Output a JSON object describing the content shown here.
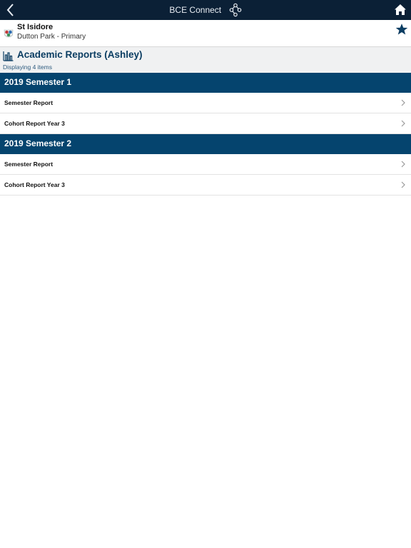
{
  "topbar": {
    "title": "BCE Connect",
    "back_icon": "chevron-left-icon",
    "logo_icon": "network-nodes-icon",
    "home_icon": "home-icon"
  },
  "school": {
    "name": "St Isidore",
    "location": "Dutton Park - Primary",
    "crest_icon": "school-crest-icon",
    "favorite_icon": "star-icon"
  },
  "page": {
    "icon": "bar-chart-icon",
    "title": "Academic Reports (Ashley)",
    "count_text": "Displaying 4 items"
  },
  "sections": [
    {
      "title": "2019 Semester 1",
      "items": [
        {
          "label": "Semester Report"
        },
        {
          "label": "Cohort Report Year 3"
        }
      ]
    },
    {
      "title": "2019 Semester 2",
      "items": [
        {
          "label": "Semester Report"
        },
        {
          "label": "Cohort Report Year 3"
        }
      ]
    }
  ],
  "colors": {
    "topbar": "#0b2036",
    "section_header": "#05446e",
    "heading_text": "#0b3d62",
    "star": "#0b3d62"
  }
}
